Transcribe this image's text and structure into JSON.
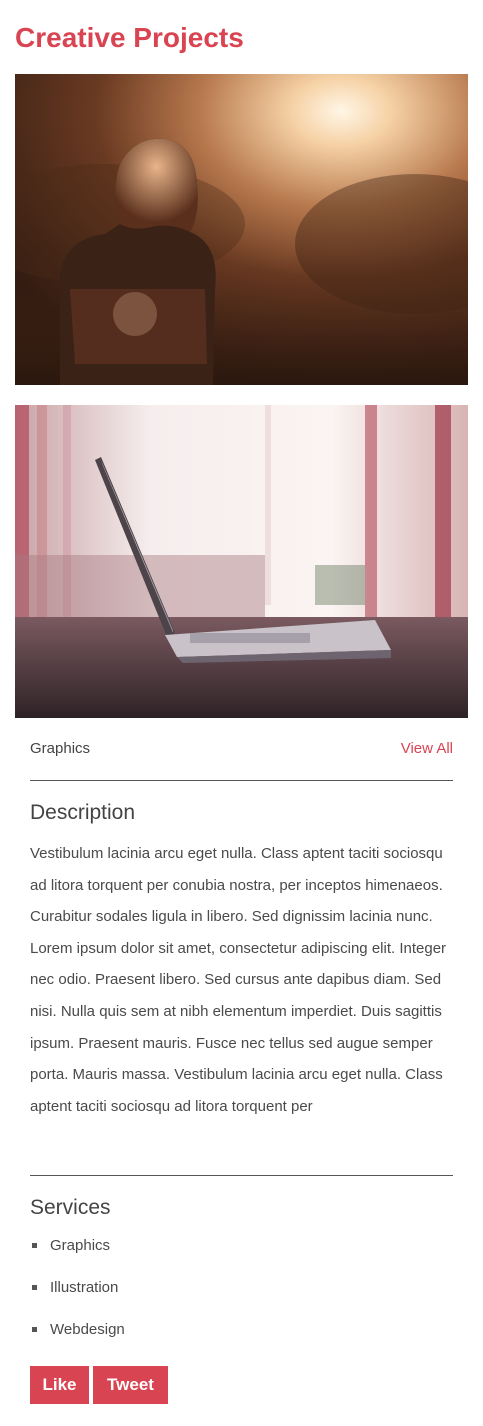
{
  "page": {
    "title": "Creative Projects"
  },
  "images": [
    {
      "subject": "woman-at-sunset-photo"
    },
    {
      "subject": "laptop-on-table-photo"
    }
  ],
  "meta": {
    "category": "Graphics",
    "view_all": "View All"
  },
  "description": {
    "heading": "Description",
    "text": "Vestibulum lacinia arcu eget nulla. Class aptent taciti sociosqu ad litora torquent per conubia nostra, per inceptos himenaeos. Curabitur sodales ligula in libero. Sed dignissim lacinia nunc. Lorem ipsum dolor sit amet, consectetur adipiscing elit. Integer nec odio. Praesent libero. Sed cursus ante dapibus diam. Sed nisi. Nulla quis sem at nibh elementum imperdiet. Duis sagittis ipsum. Praesent mauris. Fusce nec tellus sed augue semper porta. Mauris massa. Vestibulum lacinia arcu eget nulla. Class aptent taciti sociosqu ad litora torquent per"
  },
  "services": {
    "heading": "Services",
    "items": [
      "Graphics",
      "Illustration",
      "Webdesign"
    ]
  },
  "actions": {
    "like_label": "Like",
    "tweet_label": "Tweet"
  },
  "colors": {
    "accent": "#d94452",
    "text": "#4a4a4a",
    "divider": "#555555"
  }
}
